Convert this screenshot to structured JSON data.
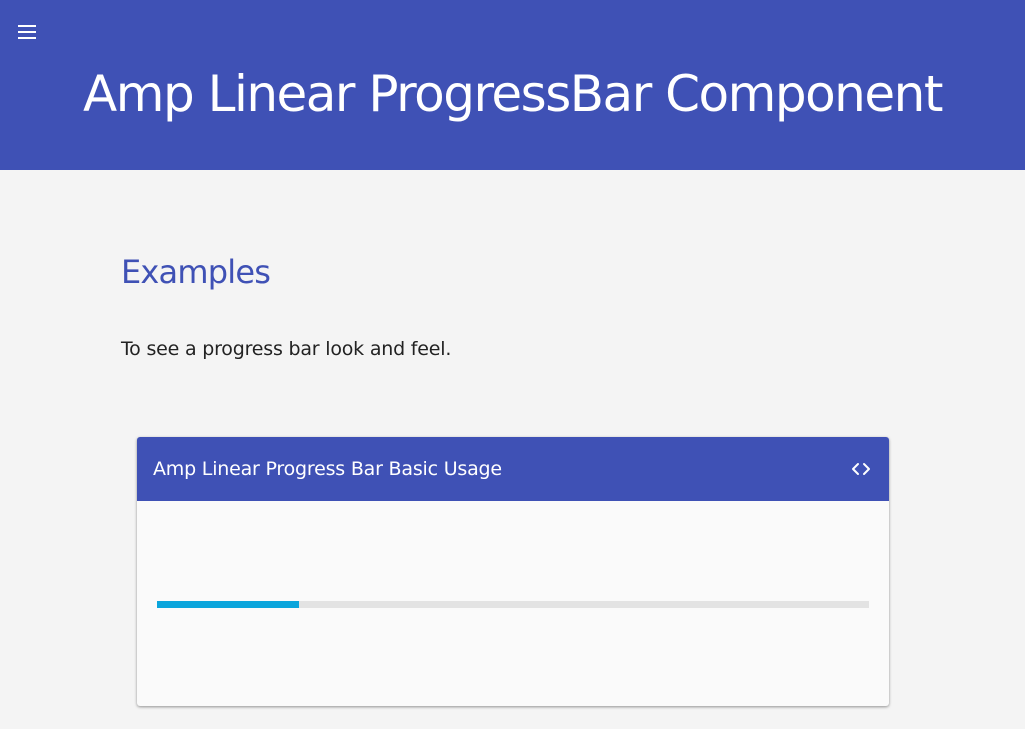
{
  "header": {
    "title": "Amp Linear ProgressBar Component",
    "menu_icon": "menu-icon",
    "background": "#3f51b5"
  },
  "section": {
    "title": "Examples",
    "description": "To see a progress bar look and feel."
  },
  "example_card": {
    "title": "Amp Linear Progress Bar Basic Usage",
    "code_toggle_icon": "code-icon",
    "progress": {
      "value": 0.2,
      "bar_color": "#0aa5dc",
      "track_color": "#e3e3e3"
    }
  }
}
